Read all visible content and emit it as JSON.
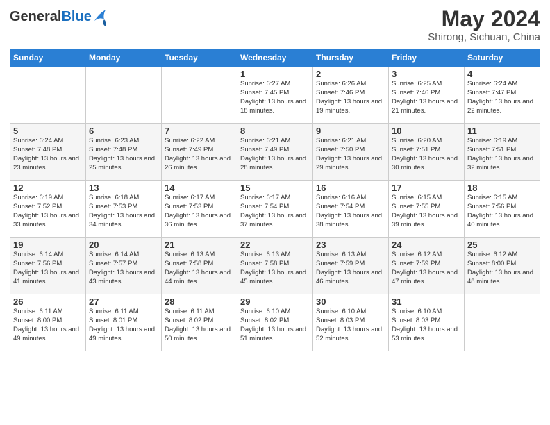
{
  "header": {
    "logo_line1": "General",
    "logo_line2": "Blue",
    "month_year": "May 2024",
    "location": "Shirong, Sichuan, China"
  },
  "weekdays": [
    "Sunday",
    "Monday",
    "Tuesday",
    "Wednesday",
    "Thursday",
    "Friday",
    "Saturday"
  ],
  "weeks": [
    [
      {
        "day": "",
        "info": ""
      },
      {
        "day": "",
        "info": ""
      },
      {
        "day": "",
        "info": ""
      },
      {
        "day": "1",
        "info": "Sunrise: 6:27 AM\nSunset: 7:45 PM\nDaylight: 13 hours\nand 18 minutes."
      },
      {
        "day": "2",
        "info": "Sunrise: 6:26 AM\nSunset: 7:46 PM\nDaylight: 13 hours\nand 19 minutes."
      },
      {
        "day": "3",
        "info": "Sunrise: 6:25 AM\nSunset: 7:46 PM\nDaylight: 13 hours\nand 21 minutes."
      },
      {
        "day": "4",
        "info": "Sunrise: 6:24 AM\nSunset: 7:47 PM\nDaylight: 13 hours\nand 22 minutes."
      }
    ],
    [
      {
        "day": "5",
        "info": "Sunrise: 6:24 AM\nSunset: 7:48 PM\nDaylight: 13 hours\nand 23 minutes."
      },
      {
        "day": "6",
        "info": "Sunrise: 6:23 AM\nSunset: 7:48 PM\nDaylight: 13 hours\nand 25 minutes."
      },
      {
        "day": "7",
        "info": "Sunrise: 6:22 AM\nSunset: 7:49 PM\nDaylight: 13 hours\nand 26 minutes."
      },
      {
        "day": "8",
        "info": "Sunrise: 6:21 AM\nSunset: 7:49 PM\nDaylight: 13 hours\nand 28 minutes."
      },
      {
        "day": "9",
        "info": "Sunrise: 6:21 AM\nSunset: 7:50 PM\nDaylight: 13 hours\nand 29 minutes."
      },
      {
        "day": "10",
        "info": "Sunrise: 6:20 AM\nSunset: 7:51 PM\nDaylight: 13 hours\nand 30 minutes."
      },
      {
        "day": "11",
        "info": "Sunrise: 6:19 AM\nSunset: 7:51 PM\nDaylight: 13 hours\nand 32 minutes."
      }
    ],
    [
      {
        "day": "12",
        "info": "Sunrise: 6:19 AM\nSunset: 7:52 PM\nDaylight: 13 hours\nand 33 minutes."
      },
      {
        "day": "13",
        "info": "Sunrise: 6:18 AM\nSunset: 7:53 PM\nDaylight: 13 hours\nand 34 minutes."
      },
      {
        "day": "14",
        "info": "Sunrise: 6:17 AM\nSunset: 7:53 PM\nDaylight: 13 hours\nand 36 minutes."
      },
      {
        "day": "15",
        "info": "Sunrise: 6:17 AM\nSunset: 7:54 PM\nDaylight: 13 hours\nand 37 minutes."
      },
      {
        "day": "16",
        "info": "Sunrise: 6:16 AM\nSunset: 7:54 PM\nDaylight: 13 hours\nand 38 minutes."
      },
      {
        "day": "17",
        "info": "Sunrise: 6:15 AM\nSunset: 7:55 PM\nDaylight: 13 hours\nand 39 minutes."
      },
      {
        "day": "18",
        "info": "Sunrise: 6:15 AM\nSunset: 7:56 PM\nDaylight: 13 hours\nand 40 minutes."
      }
    ],
    [
      {
        "day": "19",
        "info": "Sunrise: 6:14 AM\nSunset: 7:56 PM\nDaylight: 13 hours\nand 41 minutes."
      },
      {
        "day": "20",
        "info": "Sunrise: 6:14 AM\nSunset: 7:57 PM\nDaylight: 13 hours\nand 43 minutes."
      },
      {
        "day": "21",
        "info": "Sunrise: 6:13 AM\nSunset: 7:58 PM\nDaylight: 13 hours\nand 44 minutes."
      },
      {
        "day": "22",
        "info": "Sunrise: 6:13 AM\nSunset: 7:58 PM\nDaylight: 13 hours\nand 45 minutes."
      },
      {
        "day": "23",
        "info": "Sunrise: 6:13 AM\nSunset: 7:59 PM\nDaylight: 13 hours\nand 46 minutes."
      },
      {
        "day": "24",
        "info": "Sunrise: 6:12 AM\nSunset: 7:59 PM\nDaylight: 13 hours\nand 47 minutes."
      },
      {
        "day": "25",
        "info": "Sunrise: 6:12 AM\nSunset: 8:00 PM\nDaylight: 13 hours\nand 48 minutes."
      }
    ],
    [
      {
        "day": "26",
        "info": "Sunrise: 6:11 AM\nSunset: 8:00 PM\nDaylight: 13 hours\nand 49 minutes."
      },
      {
        "day": "27",
        "info": "Sunrise: 6:11 AM\nSunset: 8:01 PM\nDaylight: 13 hours\nand 49 minutes."
      },
      {
        "day": "28",
        "info": "Sunrise: 6:11 AM\nSunset: 8:02 PM\nDaylight: 13 hours\nand 50 minutes."
      },
      {
        "day": "29",
        "info": "Sunrise: 6:10 AM\nSunset: 8:02 PM\nDaylight: 13 hours\nand 51 minutes."
      },
      {
        "day": "30",
        "info": "Sunrise: 6:10 AM\nSunset: 8:03 PM\nDaylight: 13 hours\nand 52 minutes."
      },
      {
        "day": "31",
        "info": "Sunrise: 6:10 AM\nSunset: 8:03 PM\nDaylight: 13 hours\nand 53 minutes."
      },
      {
        "day": "",
        "info": ""
      }
    ]
  ]
}
